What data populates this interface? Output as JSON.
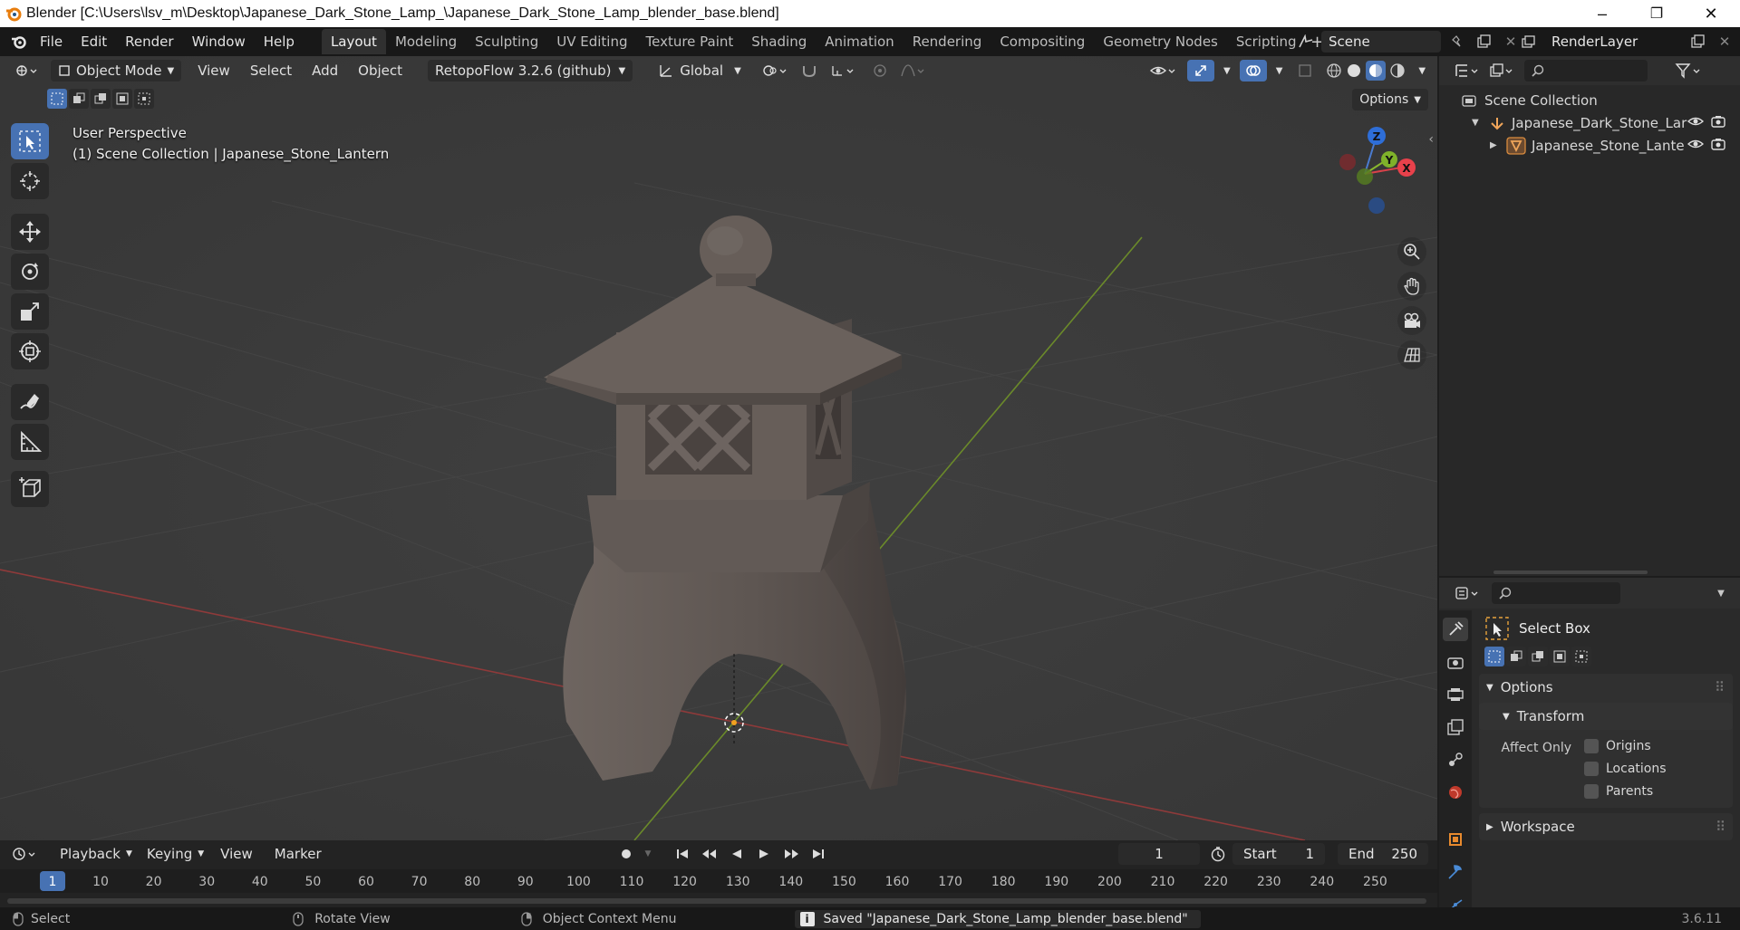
{
  "window": {
    "title": "Blender [C:\\Users\\lsv_m\\Desktop\\Japanese_Dark_Stone_Lamp_\\Japanese_Dark_Stone_Lamp_blender_base.blend]",
    "controls": [
      "–",
      "❐",
      "✕"
    ]
  },
  "menu": [
    "File",
    "Edit",
    "Render",
    "Window",
    "Help"
  ],
  "workspaces": [
    "Layout",
    "Modeling",
    "Sculpting",
    "UV Editing",
    "Texture Paint",
    "Shading",
    "Animation",
    "Rendering",
    "Compositing",
    "Geometry Nodes",
    "Scripting"
  ],
  "active_workspace": "Layout",
  "scene": {
    "name": "Scene",
    "view_layer": "RenderLayer"
  },
  "viewport": {
    "mode": "Object Mode",
    "menus": [
      "View",
      "Select",
      "Add",
      "Object"
    ],
    "addon": "RetopoFlow 3.2.6 (github)",
    "orientation": "Global",
    "options_label": "Options",
    "perspective": "User Perspective",
    "context": "(1) Scene Collection | Japanese_Stone_Lantern",
    "gizmo": {
      "z": "Z",
      "y": "Y",
      "x": "X"
    }
  },
  "outliner": {
    "root": "Scene Collection",
    "items": [
      {
        "label": "Japanese_Dark_Stone_Lar",
        "type": "empty"
      },
      {
        "label": "Japanese_Stone_Lante",
        "type": "mesh"
      }
    ]
  },
  "properties": {
    "tool_name": "Select Box",
    "panels": {
      "options": "Options",
      "transform": "Transform",
      "affect_only": "Affect Only",
      "checkboxes": [
        "Origins",
        "Locations",
        "Parents"
      ],
      "workspace": "Workspace"
    },
    "colors": {
      "accent": "#4772b3"
    }
  },
  "timeline": {
    "menus": [
      "Playback",
      "Keying",
      "View",
      "Marker"
    ],
    "current_frame": "1",
    "start_label": "Start",
    "start": "1",
    "end_label": "End",
    "end": "250",
    "ruler": [
      "1",
      "10",
      "20",
      "30",
      "40",
      "50",
      "60",
      "70",
      "80",
      "90",
      "100",
      "110",
      "120",
      "130",
      "140",
      "150",
      "160",
      "170",
      "180",
      "190",
      "200",
      "210",
      "220",
      "230",
      "240",
      "250"
    ]
  },
  "statusbar": {
    "select": "Select",
    "rotate": "Rotate View",
    "context_menu": "Object Context Menu",
    "message": "Saved \"Japanese_Dark_Stone_Lamp_blender_base.blend\"",
    "version": "3.6.11"
  }
}
